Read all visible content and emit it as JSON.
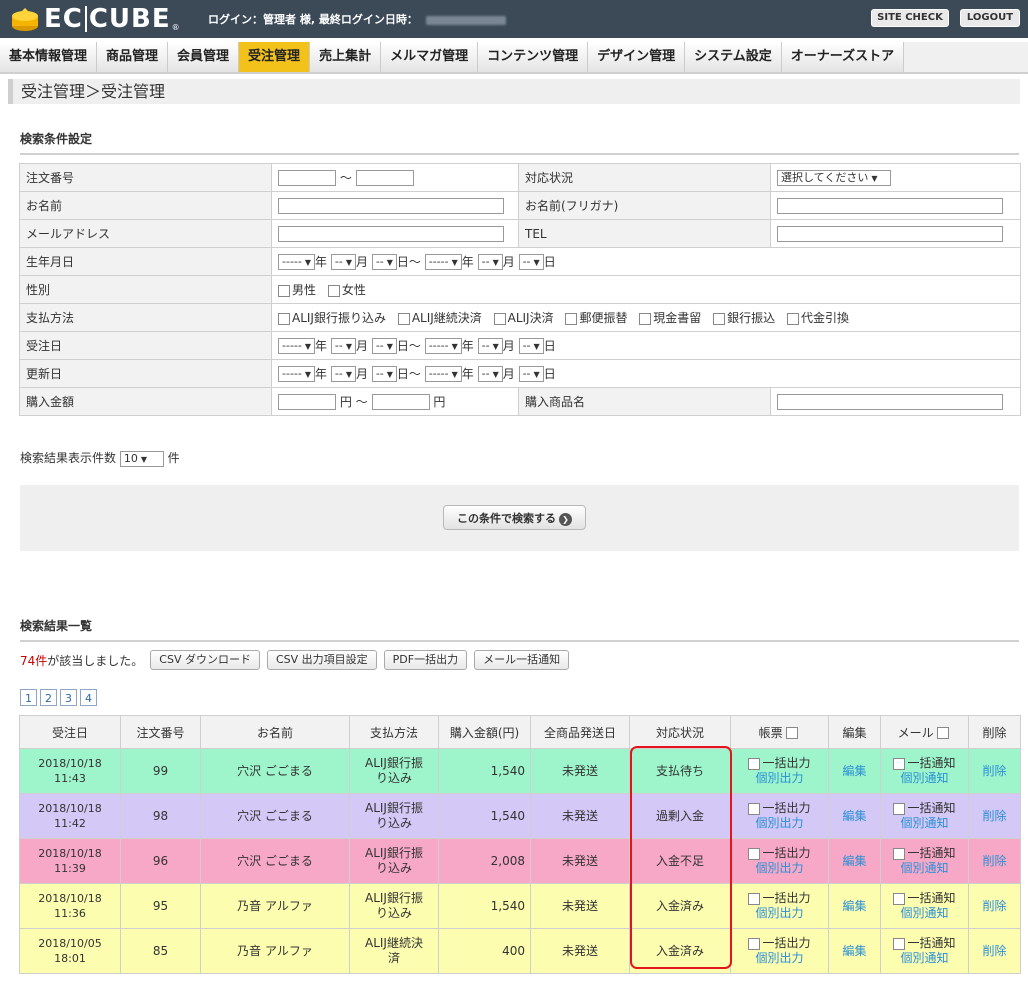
{
  "header": {
    "logo_text": "EC",
    "logo_text2": "CUBE",
    "logo_reg": "®",
    "login_text": "ログイン：管理者 様,",
    "last_login_label": "最終ログイン日時：",
    "site_check": "SITE CHECK",
    "logout": "LOGOUT"
  },
  "nav": [
    {
      "label": "基本情報管理",
      "active": false
    },
    {
      "label": "商品管理",
      "active": false
    },
    {
      "label": "会員管理",
      "active": false
    },
    {
      "label": "受注管理",
      "active": true
    },
    {
      "label": "売上集計",
      "active": false
    },
    {
      "label": "メルマガ管理",
      "active": false
    },
    {
      "label": "コンテンツ管理",
      "active": false
    },
    {
      "label": "デザイン管理",
      "active": false
    },
    {
      "label": "システム設定",
      "active": false
    },
    {
      "label": "オーナーズストア",
      "active": false
    }
  ],
  "page_title": "受注管理＞受注管理",
  "search": {
    "heading": "検索条件設定",
    "order_no": "注文番号",
    "tilde": "〜",
    "status": "対応状況",
    "status_select": "選択してください",
    "name": "お名前",
    "name_kana": "お名前(フリガナ)",
    "email": "メールアドレス",
    "tel": "TEL",
    "birth": "生年月日",
    "gender": "性別",
    "male": "男性",
    "female": "女性",
    "payment": "支払方法",
    "payment_options": [
      "ALIJ銀行振り込み",
      "ALIJ継続決済",
      "ALIJ決済",
      "郵便振替",
      "現金書留",
      "銀行振込",
      "代金引換"
    ],
    "order_date": "受注日",
    "update_date": "更新日",
    "amount": "購入金額",
    "yen": "円",
    "product_name": "購入商品名",
    "year_sel": "-----",
    "md_sel": "--",
    "year": "年",
    "month": "月",
    "day": "日",
    "day_tilde": "日〜",
    "count_label": "検索結果表示件数",
    "count_value": "10",
    "count_unit": "件",
    "search_button": "この条件で検索する",
    "go_icon": "❯"
  },
  "results": {
    "heading": "検索結果一覧",
    "hits_num": "74件",
    "hits_text": "が該当しました。",
    "csv_download": "CSV ダウンロード",
    "csv_settings": "CSV 出力項目設定",
    "pdf_bulk": "PDF一括出力",
    "mail_bulk": "メール一括通知",
    "pages": [
      "1",
      "2",
      "3",
      "4"
    ],
    "columns": [
      "受注日",
      "注文番号",
      "お名前",
      "支払方法",
      "購入金額(円)",
      "全商品発送日",
      "対応状況",
      "帳票",
      "編集",
      "メール",
      "削除"
    ],
    "bulk_output": "一括出力",
    "individual_output": "個別出力",
    "edit": "編集",
    "bulk_notify": "一括通知",
    "individual_notify": "個別通知",
    "delete": "削除",
    "rows": [
      {
        "date": "2018/10/18",
        "time": "11:43",
        "no": "99",
        "name": "穴沢 ごごまる",
        "pay1": "ALIJ銀行振",
        "pay2": "り込み",
        "amount": "1,540",
        "ship": "未発送",
        "status": "支払待ち",
        "color": "#9ff5cb"
      },
      {
        "date": "2018/10/18",
        "time": "11:42",
        "no": "98",
        "name": "穴沢 ごごまる",
        "pay1": "ALIJ銀行振",
        "pay2": "り込み",
        "amount": "1,540",
        "ship": "未発送",
        "status": "過剰入金",
        "color": "#d4c8f6"
      },
      {
        "date": "2018/10/18",
        "time": "11:39",
        "no": "96",
        "name": "穴沢 ごごまる",
        "pay1": "ALIJ銀行振",
        "pay2": "り込み",
        "amount": "2,008",
        "ship": "未発送",
        "status": "入金不足",
        "color": "#f7a8c6"
      },
      {
        "date": "2018/10/18",
        "time": "11:36",
        "no": "95",
        "name": "乃音 アルファ",
        "pay1": "ALIJ銀行振",
        "pay2": "り込み",
        "amount": "1,540",
        "ship": "未発送",
        "status": "入金済み",
        "color": "#fdfdb0"
      },
      {
        "date": "2018/10/05",
        "time": "18:01",
        "no": "85",
        "name": "乃音 アルファ",
        "pay1": "ALIJ継続決",
        "pay2": "済",
        "amount": "400",
        "ship": "未発送",
        "status": "入金済み",
        "color": "#fdfdb0"
      }
    ]
  }
}
